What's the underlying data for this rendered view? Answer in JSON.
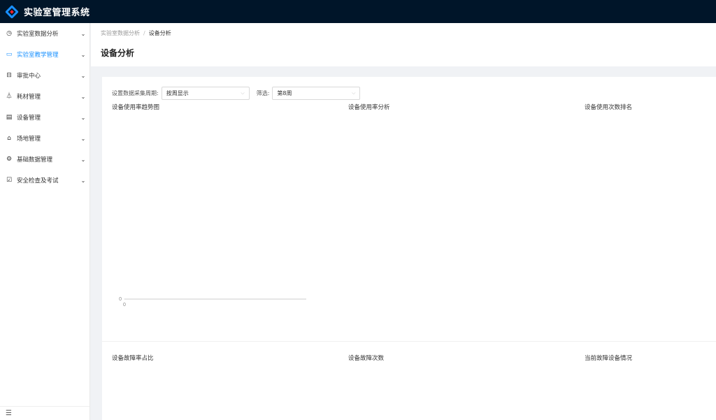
{
  "app": {
    "title": "实验室管理系统"
  },
  "sidebar": {
    "items": [
      {
        "label": "实验室数据分析",
        "icon": "clock-chart-icon"
      },
      {
        "label": "实验室教学管理",
        "icon": "book-icon"
      },
      {
        "label": "审批中心",
        "icon": "stamp-icon"
      },
      {
        "label": "耗材管理",
        "icon": "flask-icon"
      },
      {
        "label": "设备管理",
        "icon": "device-icon"
      },
      {
        "label": "场地管理",
        "icon": "building-icon"
      },
      {
        "label": "基础数据管理",
        "icon": "gear-icon"
      },
      {
        "label": "安全检查及考试",
        "icon": "checklist-icon"
      }
    ],
    "collapse_icon": "menu-fold-icon"
  },
  "breadcrumb": {
    "parent": "实验室数据分析",
    "separator": "/",
    "current": "设备分析"
  },
  "page": {
    "title": "设备分析"
  },
  "filters": {
    "period_label": "设置数据采集周期:",
    "period_value": "按周显示",
    "filter_label": "筛选:",
    "filter_value": "第8周"
  },
  "charts": {
    "usage_trend": "设备使用率趋势图",
    "usage_analysis": "设备使用率分析",
    "usage_ranking": "设备使用次数排名",
    "fault_ratio": "设备故障率占比",
    "fault_count": "设备故障次数",
    "current_fault": "当前故障设备情况"
  },
  "chart_data": {
    "type": "line",
    "title": "设备使用率趋势图",
    "x": [
      0
    ],
    "series": [
      {
        "values": [
          0
        ]
      }
    ],
    "y_tick_labels": [
      "0"
    ],
    "x_tick_labels": [
      "0"
    ]
  },
  "colors": {
    "topbar": "#001529",
    "accent": "#1890ff"
  }
}
